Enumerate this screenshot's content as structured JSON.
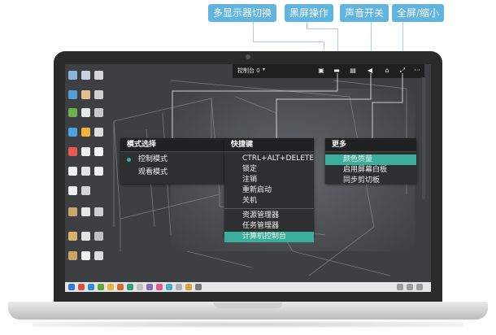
{
  "callouts": [
    {
      "label": "多显示器切换"
    },
    {
      "label": "黑屏操作"
    },
    {
      "label": "声音开关"
    },
    {
      "label": "全屏/缩小"
    }
  ],
  "toolbar": {
    "monitor_select": "控制台 0",
    "caret": "▾",
    "buttons": [
      {
        "icon": "monitor-switch-icon",
        "glyph": "▣"
      },
      {
        "icon": "blank-screen-icon",
        "glyph": "▬"
      },
      {
        "icon": "display-icon",
        "glyph": "▤"
      },
      {
        "icon": "speaker-icon",
        "glyph": "◀"
      },
      {
        "icon": "network-icon",
        "glyph": "⌂"
      },
      {
        "icon": "fullscreen-icon",
        "glyph": "⤢"
      },
      {
        "icon": "more-icon",
        "glyph": "···"
      }
    ]
  },
  "menus": {
    "mode": {
      "title": "模式选择",
      "items": [
        {
          "label": "控制模式",
          "selected": true
        },
        {
          "label": "观看模式",
          "selected": false
        }
      ]
    },
    "shortcuts": {
      "title": "快捷键",
      "items": [
        "CTRL+ALT+DELETE",
        "锁定",
        "注销",
        "重新启动",
        "关机"
      ],
      "items2": [
        "资源管理器",
        "任务管理器",
        "计算机控制台"
      ],
      "highlighted": "计算机控制台"
    },
    "more": {
      "title": "更多",
      "items": [
        "颜色质量",
        "启用屏幕白板",
        "同步剪切板"
      ],
      "highlighted": "颜色质量"
    }
  },
  "colors": {
    "callout_bg": "#5fb4e0",
    "menu_highlight": "#3cae9c",
    "menu_bg": "#2e2f31",
    "screen_bg": "#3d3f42"
  }
}
